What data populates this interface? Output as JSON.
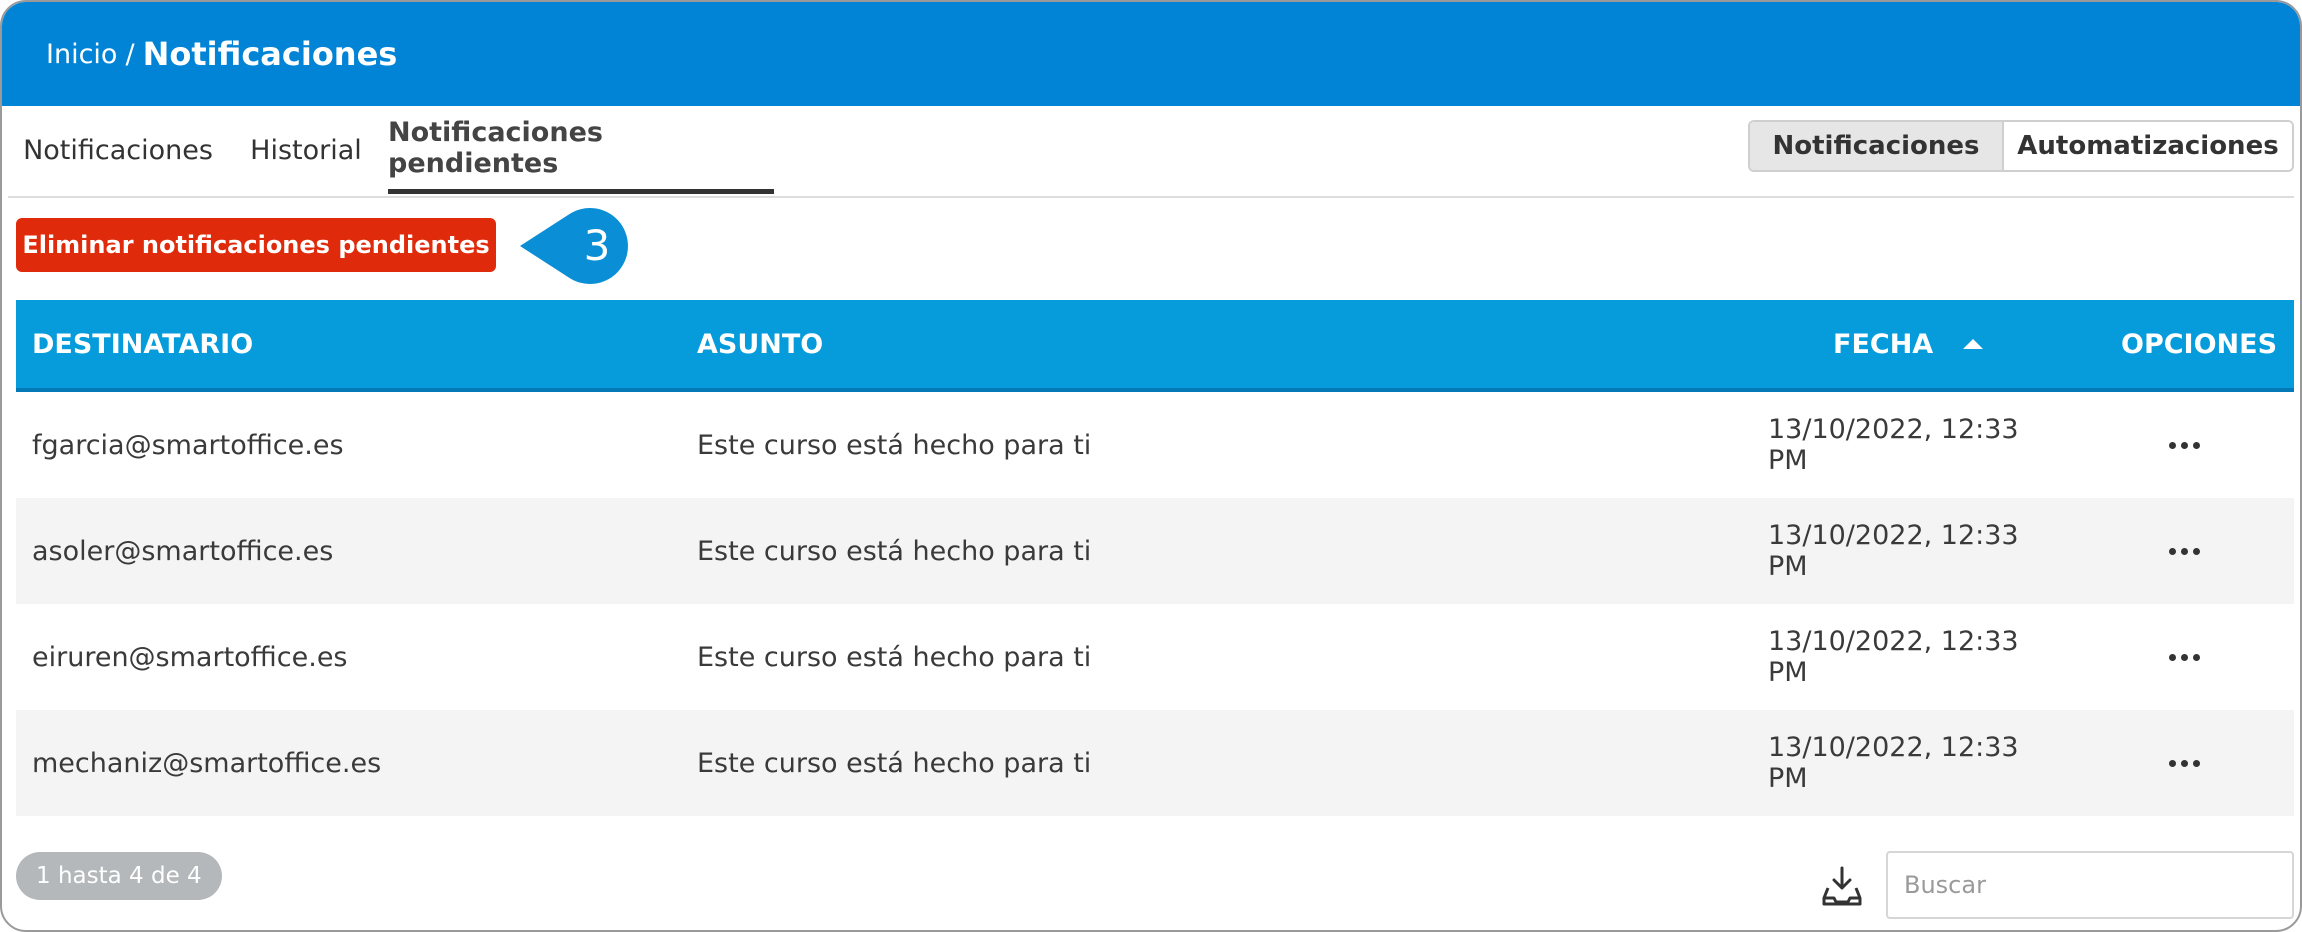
{
  "header": {
    "breadcrumb_home": "Inicio",
    "breadcrumb_separator": "/",
    "page_title": "Notificaciones"
  },
  "tabs": [
    {
      "label": "Notificaciones",
      "active": false
    },
    {
      "label": "Historial",
      "active": false
    },
    {
      "label": "Notificaciones pendientes",
      "active": true
    }
  ],
  "view_switch": {
    "notifications_label": "Notificaciones",
    "automations_label": "Automatizaciones",
    "selected": "Notificaciones"
  },
  "toolbar": {
    "delete_pending_label": "Eliminar notificaciones pendientes",
    "callout_number": "3"
  },
  "table": {
    "columns": {
      "recipient": "DESTINATARIO",
      "subject": "ASUNTO",
      "date": "FECHA",
      "options": "OPCIONES"
    },
    "sort": {
      "column": "FECHA",
      "direction": "ascending",
      "icon": "caret-up-icon"
    },
    "rows": [
      {
        "recipient": "fgarcia@smartoffice.es",
        "subject": "Este curso está hecho para ti",
        "date": "13/10/2022, 12:33 PM"
      },
      {
        "recipient": "asoler@smartoffice.es",
        "subject": "Este curso está hecho para ti",
        "date": "13/10/2022, 12:33 PM"
      },
      {
        "recipient": "eiruren@smartoffice.es",
        "subject": "Este curso está hecho para ti",
        "date": "13/10/2022, 12:33 PM"
      },
      {
        "recipient": "mechaniz@smartoffice.es",
        "subject": "Este curso está hecho para ti",
        "date": "13/10/2022, 12:33 PM"
      }
    ]
  },
  "footer": {
    "pagination_text": "1 hasta 4 de 4",
    "download_icon": "download-tray-icon",
    "search_placeholder": "Buscar"
  },
  "colors": {
    "header_blue": "#0284d6",
    "table_header_blue": "#069bdb",
    "delete_red": "#df2b0b",
    "callout_blue": "#0a8fd6"
  }
}
